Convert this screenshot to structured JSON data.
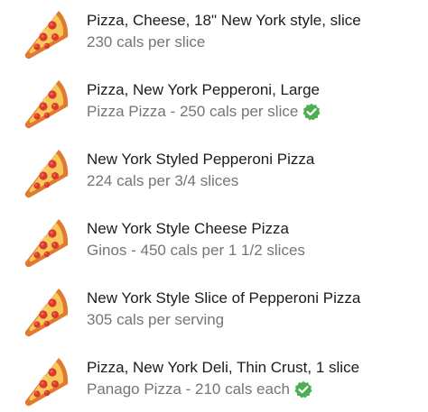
{
  "food_list": {
    "items": [
      {
        "title": "Pizza, Cheese, 18\" New York style, slice",
        "subtitle": "230 cals per slice",
        "verified": false,
        "icon": "pizza-slice-icon"
      },
      {
        "title": "Pizza, New York Pepperoni, Large",
        "subtitle": "Pizza Pizza - 250 cals per slice",
        "verified": true,
        "icon": "pizza-slice-icon"
      },
      {
        "title": "New York Styled Pepperoni Pizza",
        "subtitle": "224 cals per 3/4 slices",
        "verified": false,
        "icon": "pizza-slice-icon"
      },
      {
        "title": "New York Style Cheese Pizza",
        "subtitle": "Ginos - 450 cals per 1 1/2 slices",
        "verified": false,
        "icon": "pizza-slice-icon"
      },
      {
        "title": "New York Style Slice of Pepperoni Pizza",
        "subtitle": "305 cals per serving",
        "verified": false,
        "icon": "pizza-slice-icon"
      },
      {
        "title": "Pizza, New York Deli, Thin Crust, 1 slice",
        "subtitle": "Panago Pizza - 210 cals each",
        "verified": true,
        "icon": "pizza-slice-icon"
      }
    ]
  },
  "colors": {
    "title_text": "#1c1c1c",
    "subtitle_text": "#757575",
    "verified_badge": "#4caf50"
  }
}
